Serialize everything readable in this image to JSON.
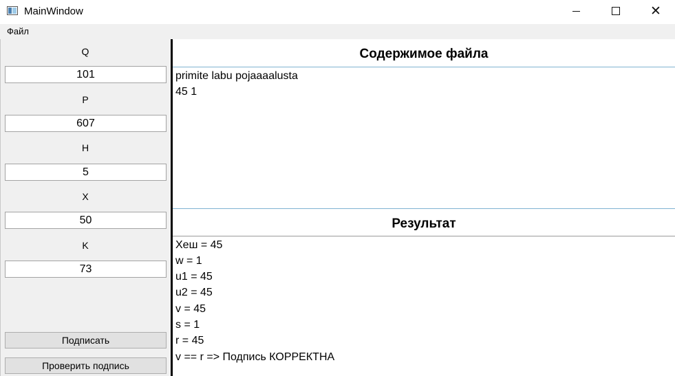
{
  "window": {
    "title": "MainWindow",
    "minimize": "minimize",
    "maximize": "maximize",
    "close": "close"
  },
  "menu": {
    "items": [
      {
        "label": "Файл"
      }
    ]
  },
  "params": [
    {
      "label": "Q",
      "value": "101"
    },
    {
      "label": "P",
      "value": "607"
    },
    {
      "label": "H",
      "value": "5"
    },
    {
      "label": "X",
      "value": "50"
    },
    {
      "label": "K",
      "value": "73"
    }
  ],
  "buttons": {
    "sign": "Подписать",
    "verify": "Проверить подпись"
  },
  "file_section": {
    "title": "Содержимое файла",
    "lines": [
      "primite labu pojaaaalusta",
      "45 1"
    ]
  },
  "result_section": {
    "title": "Результат",
    "lines": [
      "Хеш = 45",
      "w = 1",
      "u1 = 45",
      "u2 = 45",
      "v = 45",
      "s = 1",
      "r = 45",
      "v == r => Подпись КОРРЕКТНА"
    ]
  }
}
